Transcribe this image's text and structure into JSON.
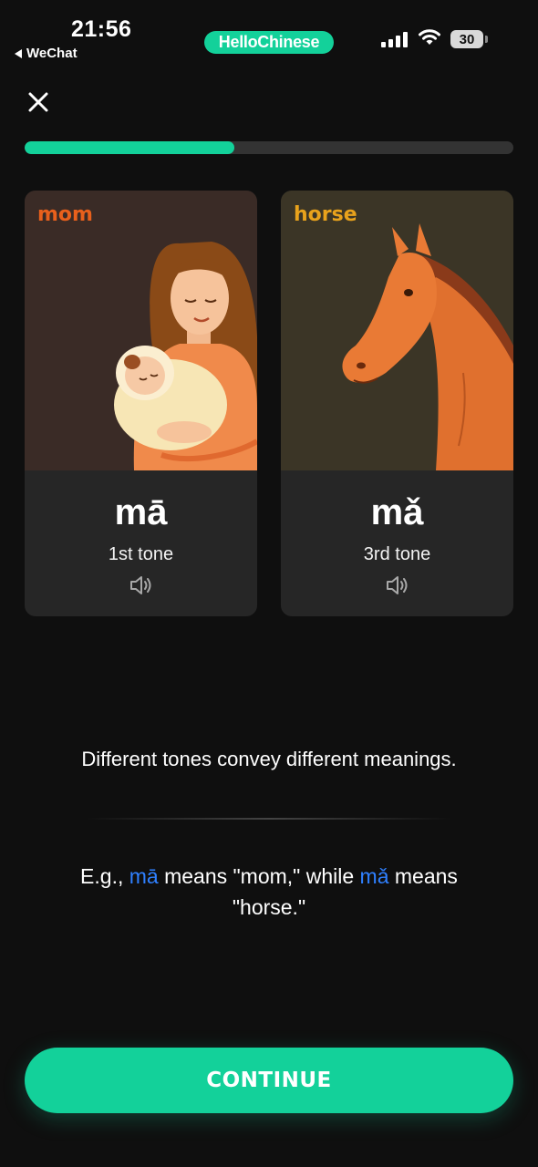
{
  "status_bar": {
    "time": "21:56",
    "back_app": "WeChat",
    "app_pill": "HelloChinese",
    "battery": "30",
    "icons": [
      "signal-bars-icon",
      "wifi-icon",
      "battery-icon"
    ]
  },
  "progress": {
    "value": 0.43
  },
  "cards": [
    {
      "label": "mom",
      "label_color": "#e8601c",
      "pinyin": "mā",
      "tone": "1st tone",
      "bg": "#3a2b26"
    },
    {
      "label": "horse",
      "label_color": "#e8a21c",
      "pinyin": "mǎ",
      "tone": "3rd tone",
      "bg": "#3b3526"
    }
  ],
  "description": "Different tones convey different meanings.",
  "example": {
    "prefix": "E.g., ",
    "word1": "mā",
    "middle": " means \"mom,\" while ",
    "word2": "mǎ",
    "suffix": " means \"horse.\""
  },
  "continue_label": "CONTINUE",
  "colors": {
    "accent": "#13d19a",
    "highlight": "#2f80ff",
    "background": "#0f0f0f"
  }
}
